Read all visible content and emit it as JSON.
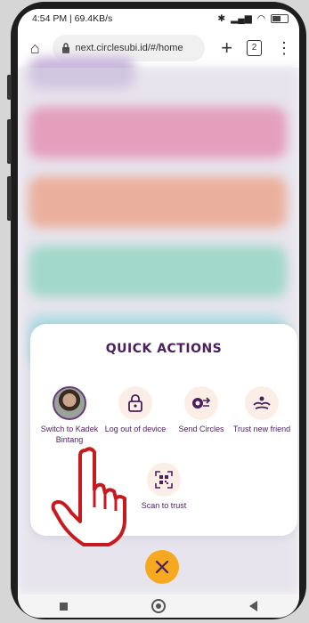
{
  "status_bar": {
    "time_info": "4:54 PM | 69.4KB/s",
    "battery": ""
  },
  "browser": {
    "url": "next.circlesubi.id/#/home",
    "tab_count": "2"
  },
  "quick_actions": {
    "title": "QUICK ACTIONS",
    "items": [
      {
        "label": "Switch to Kadek Bintang",
        "icon": "avatar"
      },
      {
        "label": "Log out of device",
        "icon": "lock-icon"
      },
      {
        "label": "Send Circles",
        "icon": "send-circles-icon"
      },
      {
        "label": "Trust new friend",
        "icon": "trust-friend-icon"
      },
      {
        "label": "Scan to trust",
        "icon": "qr-scan-icon"
      }
    ]
  },
  "colors": {
    "accent_purple": "#4a1f5c",
    "close_button": "#f6a81e",
    "icon_bg": "#fbeee6"
  }
}
